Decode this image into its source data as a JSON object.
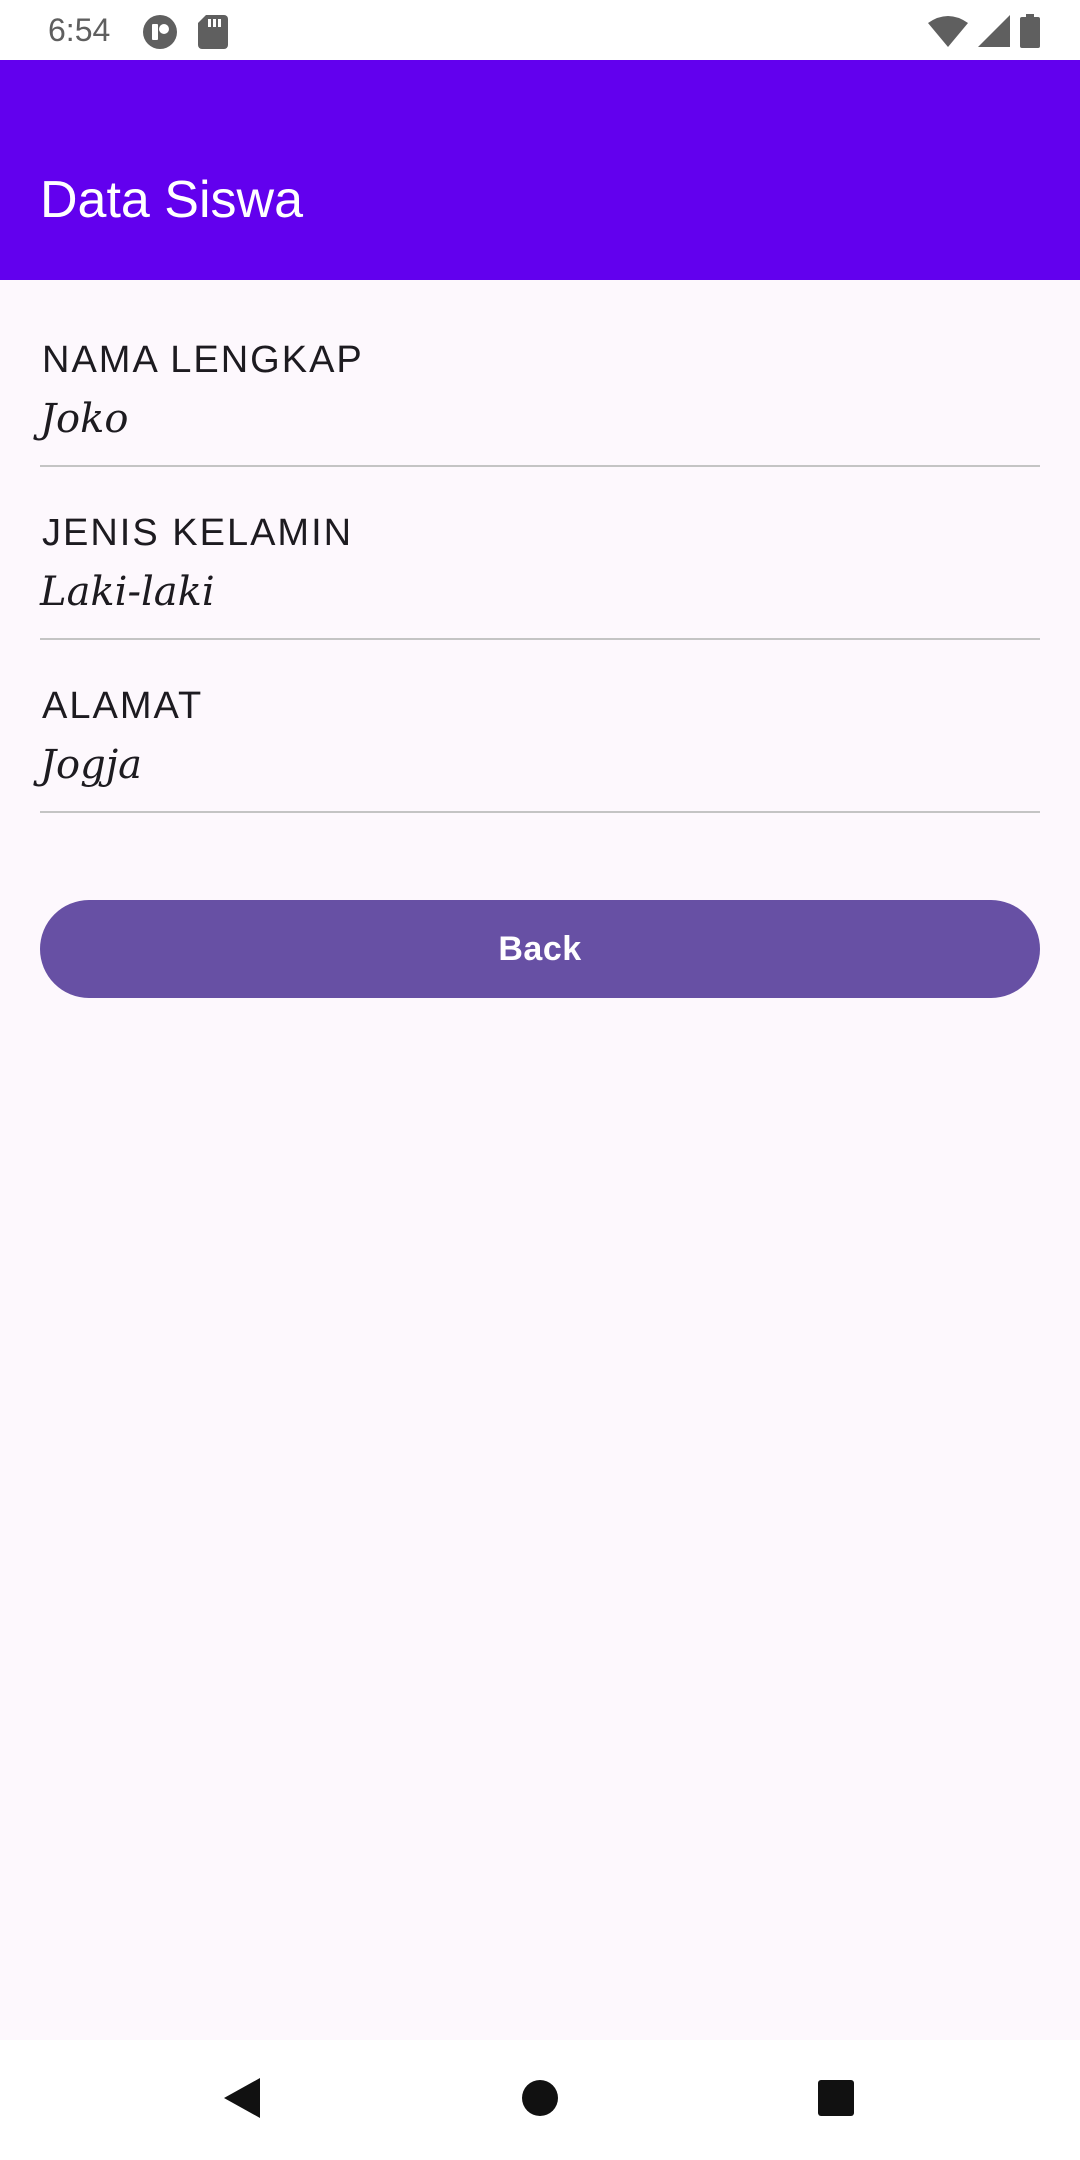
{
  "status_bar": {
    "time": "6:54",
    "left_icons": [
      "cast-icon",
      "sd-card-icon"
    ],
    "right_icons": [
      "wifi-icon",
      "cell-signal-icon",
      "battery-icon"
    ]
  },
  "app_bar": {
    "title": "Data Siswa",
    "color": "#6200ee"
  },
  "fields": [
    {
      "label": "NAMA LENGKAP",
      "value": "Joko"
    },
    {
      "label": "JENIS KELAMIN",
      "value": "Laki-laki"
    },
    {
      "label": "ALAMAT",
      "value": "Jogja"
    }
  ],
  "actions": {
    "back_label": "Back",
    "button_color": "#6750a4"
  },
  "nav_bar": {
    "icons": [
      "back-triangle-icon",
      "home-circle-icon",
      "recents-square-icon"
    ]
  }
}
